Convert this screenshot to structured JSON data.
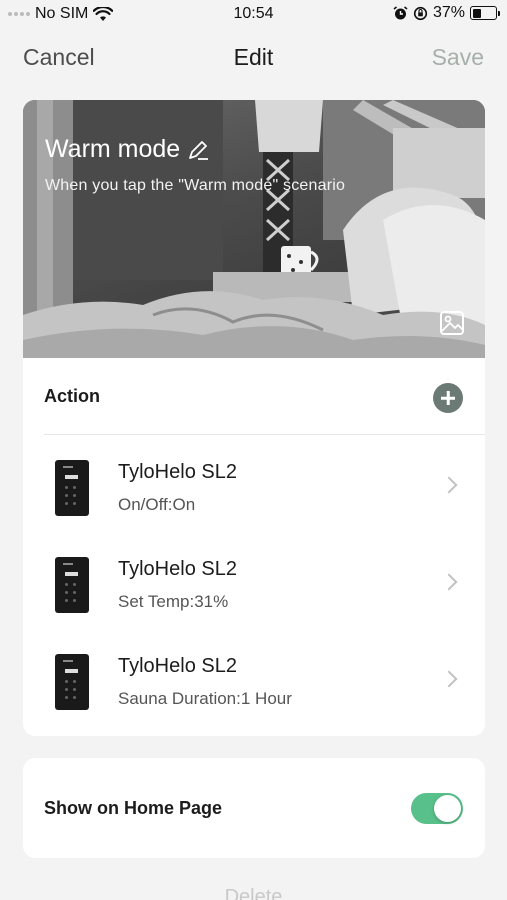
{
  "status_bar": {
    "carrier": "No SIM",
    "time": "10:54",
    "battery_percent": "37%",
    "battery_level": 0.37,
    "icons": [
      "wifi-icon",
      "alarm-icon",
      "orientation-lock-icon",
      "battery-icon"
    ]
  },
  "nav": {
    "cancel_label": "Cancel",
    "title": "Edit",
    "save_label": "Save"
  },
  "scene": {
    "name": "Warm mode",
    "description": "When you tap the \"Warm mode\" scenario",
    "edit_icon": "pencil-icon",
    "image_icon": "image-icon"
  },
  "action_section": {
    "header": "Action",
    "add_icon": "plus-circle-icon",
    "items": [
      {
        "device": "TyloHelo SL2",
        "detail": "On/Off:On"
      },
      {
        "device": "TyloHelo SL2",
        "detail": "Set Temp:31%"
      },
      {
        "device": "TyloHelo SL2",
        "detail": "Sauna Duration:1 Hour"
      }
    ]
  },
  "home_page": {
    "label": "Show on Home Page",
    "enabled": true
  },
  "delete_label": "Delete",
  "colors": {
    "accent_green": "#58c08a",
    "save_disabled": "#a7afab",
    "background": "#f3f3f3"
  }
}
